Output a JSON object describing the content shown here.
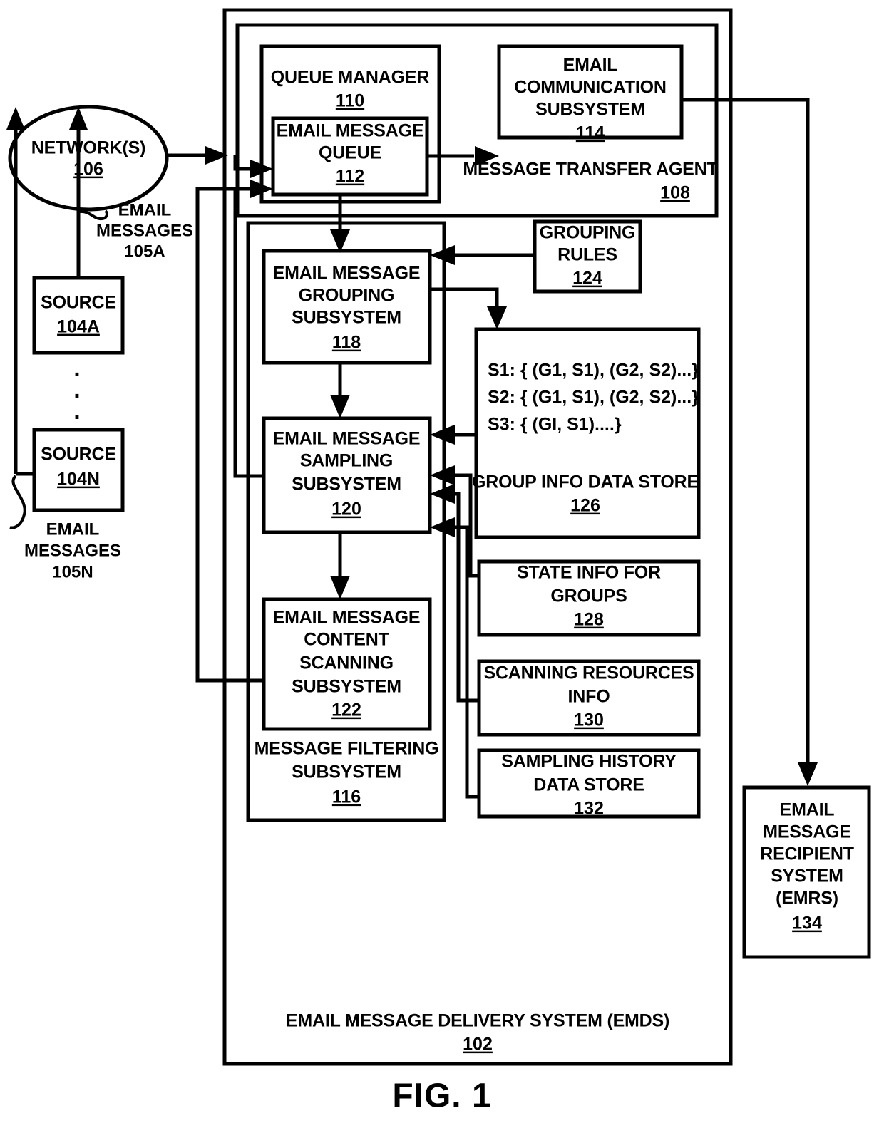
{
  "figure": {
    "caption": "FIG. 1"
  },
  "nodes": {
    "network": {
      "label": "NETWORK(S)",
      "ref": "106"
    },
    "source_a": {
      "label": "SOURCE",
      "ref": "104A"
    },
    "source_n": {
      "label": "SOURCE",
      "ref": "104N"
    },
    "email_messages_a": {
      "line1": "EMAIL",
      "line2": "MESSAGES",
      "ref": "105A"
    },
    "email_messages_n": {
      "line1": "EMAIL",
      "line2": "MESSAGES",
      "ref": "105N"
    },
    "queue_manager": {
      "label": "QUEUE MANAGER",
      "ref": "110"
    },
    "email_message_queue": {
      "line1": "EMAIL MESSAGE",
      "line2": "QUEUE",
      "ref": "112"
    },
    "email_communication_subsystem": {
      "line1": "EMAIL",
      "line2": "COMMUNICATION",
      "line3": "SUBSYSTEM",
      "ref": "114"
    },
    "message_transfer_agent": {
      "label": "MESSAGE TRANSFER AGENT",
      "ref": "108"
    },
    "grouping_subsystem": {
      "line1": "EMAIL MESSAGE",
      "line2": "GROUPING",
      "line3": "SUBSYSTEM",
      "ref": "118"
    },
    "grouping_rules": {
      "line1": "GROUPING",
      "line2": "RULES",
      "ref": "124"
    },
    "sampling_subsystem": {
      "line1": "EMAIL MESSAGE",
      "line2": "SAMPLING",
      "line3": "SUBSYSTEM",
      "ref": "120"
    },
    "group_info_data_store": {
      "label": "GROUP INFO DATA STORE",
      "ref": "126",
      "entries": [
        "S1: { (G1, S1), (G2, S2)...}",
        "S2: { (G1, S1), (G2, S2)...}",
        "S3: { (GI, S1)....}"
      ]
    },
    "state_info_for_groups": {
      "line1": "STATE INFO FOR",
      "line2": "GROUPS",
      "ref": "128"
    },
    "scanning_resources_info": {
      "line1": "SCANNING RESOURCES",
      "line2": "INFO",
      "ref": "130"
    },
    "sampling_history_data_store": {
      "line1": "SAMPLING HISTORY",
      "line2": "DATA STORE",
      "ref": "132"
    },
    "content_scanning_subsystem": {
      "line1": "EMAIL MESSAGE",
      "line2": "CONTENT",
      "line3": "SCANNING",
      "line4": "SUBSYSTEM",
      "ref": "122"
    },
    "message_filtering_subsystem": {
      "line1": "MESSAGE FILTERING",
      "line2": "SUBSYSTEM",
      "ref": "116"
    },
    "email_message_recipient_system": {
      "line1": "EMAIL",
      "line2": "MESSAGE",
      "line3": "RECIPIENT",
      "line4": "SYSTEM",
      "line5": "(EMRS)",
      "ref": "134"
    },
    "email_message_delivery_system": {
      "label": "EMAIL MESSAGE DELIVERY SYSTEM (EMDS)",
      "ref": "102"
    },
    "vertical_ellipsis": {
      "glyph": "."
    }
  }
}
